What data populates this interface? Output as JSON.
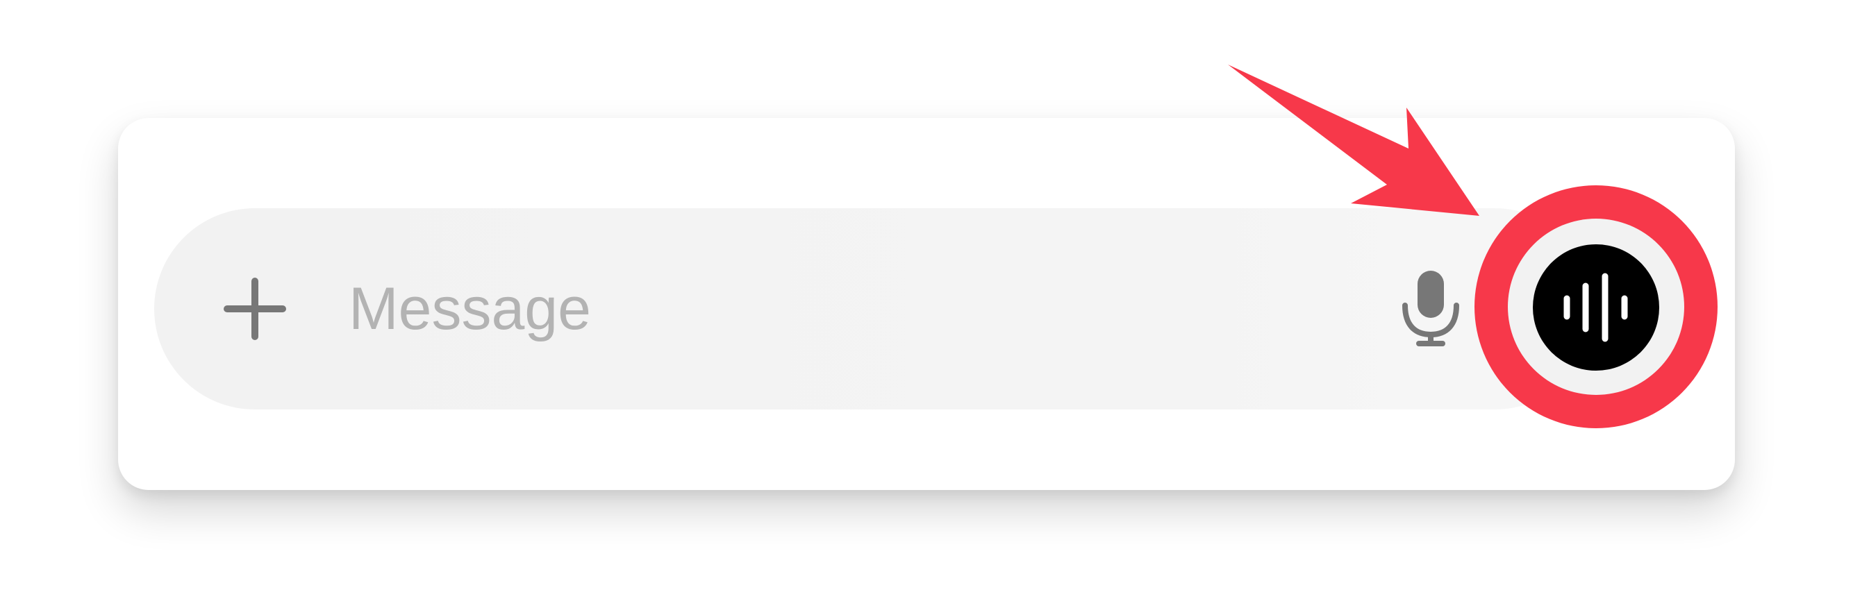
{
  "composer": {
    "placeholder": "Message",
    "value": ""
  },
  "icons": {
    "attach": "plus-icon",
    "dictation": "microphone-icon",
    "voice_mode": "voice-waveform-icon",
    "annotation": "annotation-arrow-icon"
  },
  "colors": {
    "annotation": "#f7384a",
    "voice_button": "#000000",
    "input_background": "#f2f2f2",
    "placeholder": "#b3b3b3",
    "icon_gray": "#777777"
  }
}
